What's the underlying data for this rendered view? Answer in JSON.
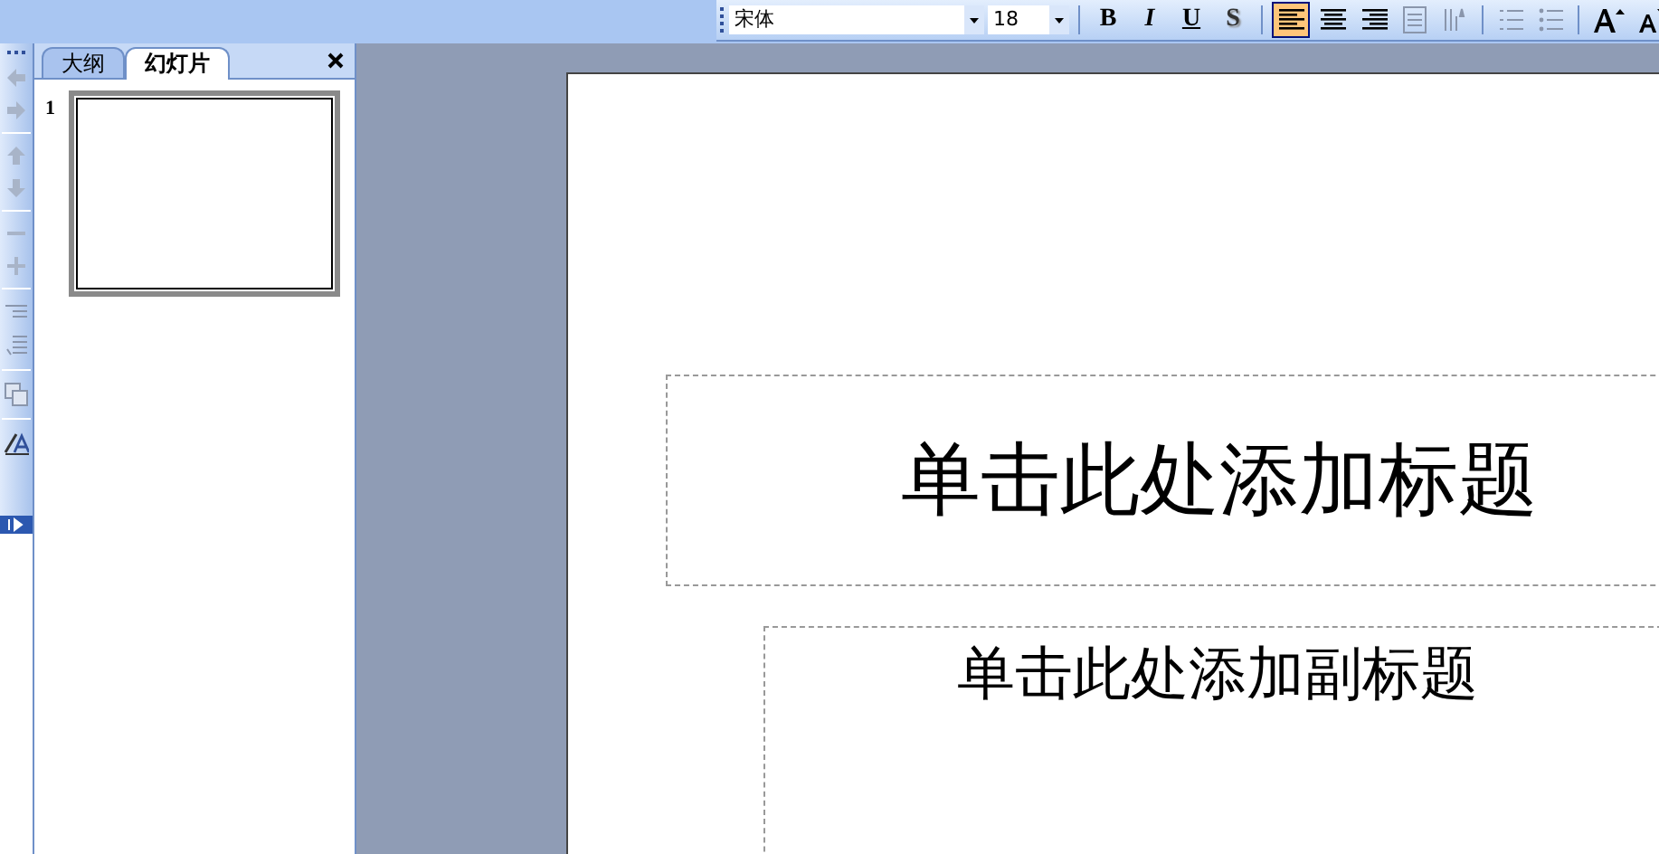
{
  "toolbar": {
    "font": "宋体",
    "size": "18",
    "format_buttons": [
      {
        "label": "B",
        "kind": "bold"
      },
      {
        "label": "I",
        "kind": "italic"
      },
      {
        "label": "U",
        "kind": "underline"
      },
      {
        "label": "S",
        "kind": "shadow"
      }
    ],
    "align_buttons": [
      {
        "kind": "left",
        "selected": true
      },
      {
        "kind": "center",
        "selected": false
      },
      {
        "kind": "right",
        "selected": false
      }
    ]
  },
  "panel": {
    "tabs": [
      {
        "label": "大纲",
        "selected": false
      },
      {
        "label": "幻灯片",
        "selected": true
      }
    ],
    "slides": [
      {
        "number": "1",
        "selected": true
      }
    ]
  },
  "slide": {
    "title_placeholder": "单击此处添加标题",
    "subtitle_placeholder": "单击此处添加副标题"
  }
}
